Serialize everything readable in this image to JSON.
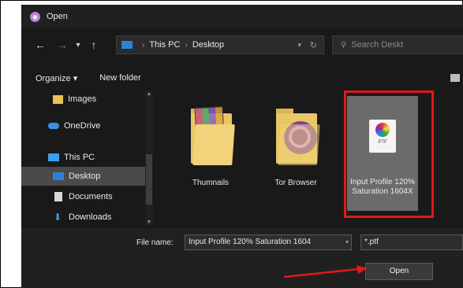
{
  "window": {
    "title": "Open"
  },
  "nav": {
    "back": "←",
    "forward": "→",
    "recent": "▾",
    "up": "↑",
    "address": [
      "This PC",
      "Desktop"
    ],
    "address_sep": "›",
    "refresh": "↻",
    "search_placeholder": "Search Deskt"
  },
  "commands": {
    "organize": "Organize ▾",
    "new_folder": "New folder"
  },
  "sidebar": {
    "items": [
      {
        "label": "Images",
        "icon": "folder-icon"
      },
      {
        "label": "OneDrive",
        "icon": "cloud-icon"
      },
      {
        "label": "This PC",
        "icon": "computer-icon"
      },
      {
        "label": "Desktop",
        "icon": "desktop-icon",
        "selected": true
      },
      {
        "label": "Documents",
        "icon": "document-icon"
      },
      {
        "label": "Downloads",
        "icon": "download-icon"
      }
    ]
  },
  "files": [
    {
      "name": "Thumnails",
      "icon": "folder-icon"
    },
    {
      "name": "Tor Browser",
      "icon": "folder-icon"
    },
    {
      "name": "Input Profile 120% Saturation 1604X",
      "icon": "icc-profile-icon",
      "ext": "PTF",
      "selected": true
    }
  ],
  "bottom": {
    "file_name_label": "File name:",
    "file_name_value": "Input Profile 120% Saturation 1604",
    "filter_value": "*.ptf",
    "open_label": "Open"
  },
  "colors": {
    "highlight": "#e11919",
    "arrow": "#e11919",
    "dialog_bg": "#191919"
  }
}
